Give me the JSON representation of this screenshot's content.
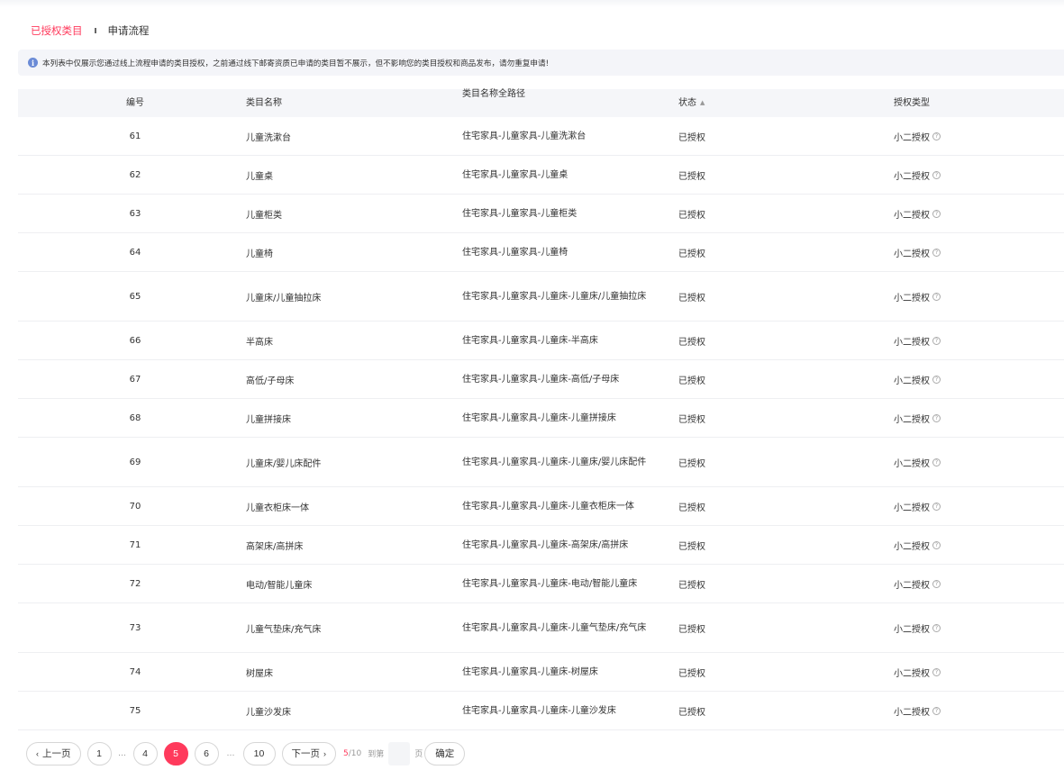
{
  "tabs": [
    {
      "label": "已授权类目",
      "active": true
    },
    {
      "label": "申请流程",
      "active": false
    }
  ],
  "notice": {
    "icon": "info-icon",
    "text": "本列表中仅展示您通过线上流程申请的类目授权，之前通过线下邮寄资质已申请的类目暂不展示，但不影响您的类目授权和商品发布，请勿重复申请!"
  },
  "table": {
    "headers": {
      "id": "编号",
      "name": "类目名称",
      "path": "类目名称全路径",
      "status": "状态",
      "type": "授权类型"
    },
    "rows": [
      {
        "id": "61",
        "name": "儿童洗漱台",
        "path": "住宅家具-儿童家具-儿童洗漱台",
        "status": "已授权",
        "type": "小二授权"
      },
      {
        "id": "62",
        "name": "儿童桌",
        "path": "住宅家具-儿童家具-儿童桌",
        "status": "已授权",
        "type": "小二授权"
      },
      {
        "id": "63",
        "name": "儿童柜类",
        "path": "住宅家具-儿童家具-儿童柜类",
        "status": "已授权",
        "type": "小二授权"
      },
      {
        "id": "64",
        "name": "儿童椅",
        "path": "住宅家具-儿童家具-儿童椅",
        "status": "已授权",
        "type": "小二授权"
      },
      {
        "id": "65",
        "name": "儿童床/儿童抽拉床",
        "path": "住宅家具-儿童家具-儿童床-儿童床/儿童抽拉床",
        "status": "已授权",
        "type": "小二授权"
      },
      {
        "id": "66",
        "name": "半高床",
        "path": "住宅家具-儿童家具-儿童床-半高床",
        "status": "已授权",
        "type": "小二授权"
      },
      {
        "id": "67",
        "name": "高低/子母床",
        "path": "住宅家具-儿童家具-儿童床-高低/子母床",
        "status": "已授权",
        "type": "小二授权"
      },
      {
        "id": "68",
        "name": "儿童拼接床",
        "path": "住宅家具-儿童家具-儿童床-儿童拼接床",
        "status": "已授权",
        "type": "小二授权"
      },
      {
        "id": "69",
        "name": "儿童床/婴儿床配件",
        "path": "住宅家具-儿童家具-儿童床-儿童床/婴儿床配件",
        "status": "已授权",
        "type": "小二授权"
      },
      {
        "id": "70",
        "name": "儿童衣柜床一体",
        "path": "住宅家具-儿童家具-儿童床-儿童衣柜床一体",
        "status": "已授权",
        "type": "小二授权"
      },
      {
        "id": "71",
        "name": "高架床/高拼床",
        "path": "住宅家具-儿童家具-儿童床-高架床/高拼床",
        "status": "已授权",
        "type": "小二授权"
      },
      {
        "id": "72",
        "name": "电动/智能儿童床",
        "path": "住宅家具-儿童家具-儿童床-电动/智能儿童床",
        "status": "已授权",
        "type": "小二授权"
      },
      {
        "id": "73",
        "name": "儿童气垫床/充气床",
        "path": "住宅家具-儿童家具-儿童床-儿童气垫床/充气床",
        "status": "已授权",
        "type": "小二授权"
      },
      {
        "id": "74",
        "name": "树屋床",
        "path": "住宅家具-儿童家具-儿童床-树屋床",
        "status": "已授权",
        "type": "小二授权"
      },
      {
        "id": "75",
        "name": "儿童沙发床",
        "path": "住宅家具-儿童家具-儿童床-儿童沙发床",
        "status": "已授权",
        "type": "小二授权"
      }
    ]
  },
  "pagination": {
    "prev_label": "上一页",
    "next_label": "下一页",
    "pages": [
      "1",
      "…",
      "4",
      "5",
      "6",
      "…",
      "10"
    ],
    "current": "5",
    "total": "10",
    "goto_prefix": "到第",
    "goto_suffix": "页",
    "goto_value": "",
    "confirm_label": "确定"
  },
  "colors": {
    "accent": "#ff3a5c",
    "info": "#6b8bd6",
    "header_bg": "#f5f6f9"
  }
}
